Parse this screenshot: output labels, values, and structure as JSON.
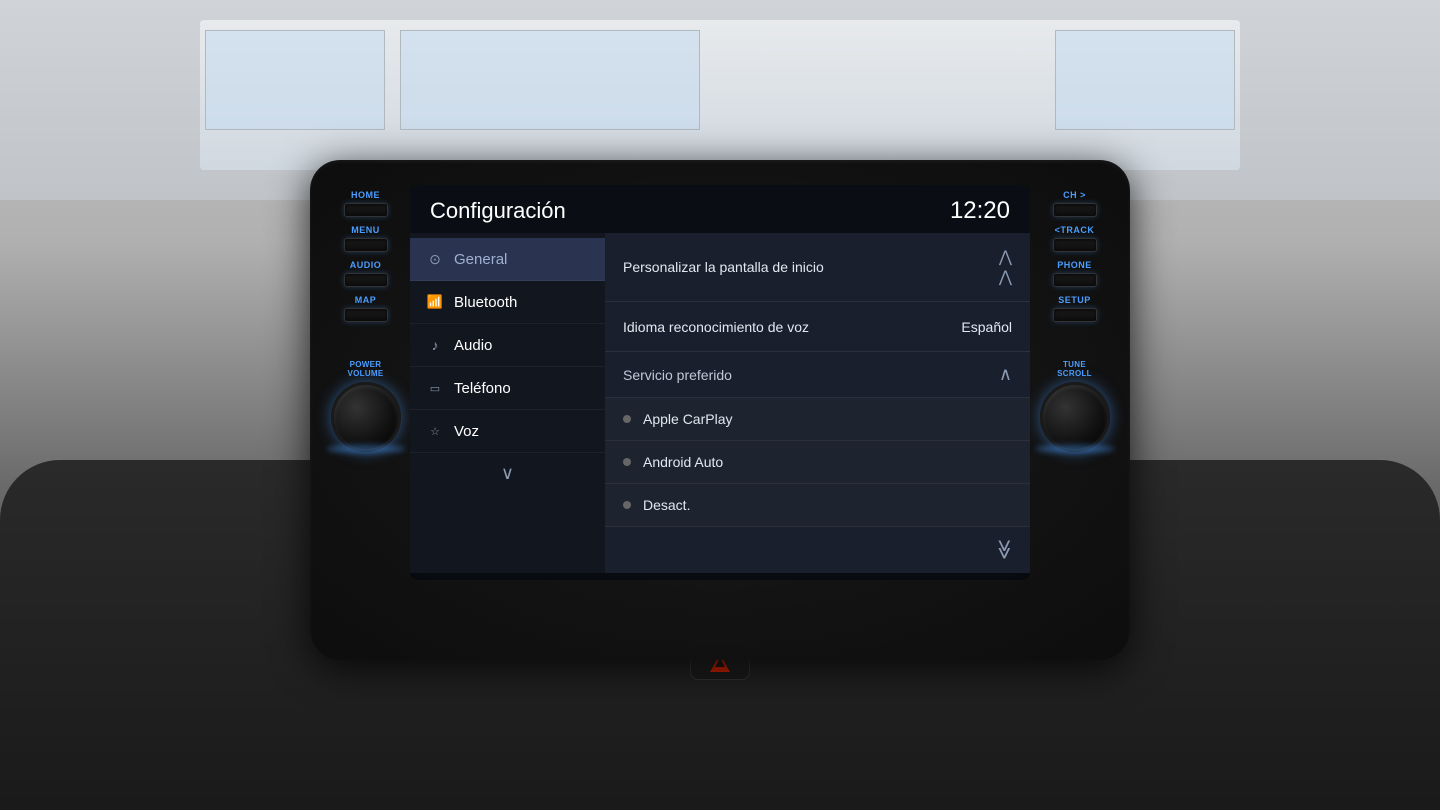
{
  "background": {
    "ceiling_color": "#c8ccd0",
    "dashboard_color": "#1a1a1a"
  },
  "unit": {
    "left_buttons": [
      {
        "label": "HOME",
        "id": "home"
      },
      {
        "label": "MENU",
        "id": "menu"
      },
      {
        "label": "AUDIO",
        "id": "audio"
      },
      {
        "label": "MAP",
        "id": "map"
      }
    ],
    "left_knob_label": "POWER\nVOLUME",
    "right_buttons": [
      {
        "label": "CH >",
        "id": "ch"
      },
      {
        "label": "<TRACK",
        "id": "track"
      },
      {
        "label": "PHONE",
        "id": "phone"
      },
      {
        "label": "SETUP",
        "id": "setup"
      }
    ],
    "right_knob_label": "TUNE\nSCROLL"
  },
  "screen": {
    "title": "Configuración",
    "time": "12:20",
    "menu": {
      "items": [
        {
          "id": "general",
          "icon": "⊙",
          "label": "General",
          "active": true
        },
        {
          "id": "bluetooth",
          "icon": "⦿",
          "label": "Bluetooth",
          "active": false
        },
        {
          "id": "audio",
          "icon": "♪",
          "label": "Audio",
          "active": false
        },
        {
          "id": "telefono",
          "icon": "□",
          "label": "Teléfono",
          "active": false
        },
        {
          "id": "voz",
          "icon": "☆",
          "label": "Voz",
          "active": false
        }
      ],
      "more_label": "∨"
    },
    "content": {
      "rows": [
        {
          "id": "personalizar",
          "text": "Personalizar la pantalla de inicio",
          "value": "",
          "has_double_chevron": true
        },
        {
          "id": "idioma",
          "text": "Idioma reconocimiento de voz",
          "value": "Español",
          "has_double_chevron": false
        }
      ],
      "servicio": {
        "label": "Servicio preferido",
        "expanded": true,
        "options": [
          {
            "id": "carplay",
            "label": "Apple CarPlay",
            "selected": false
          },
          {
            "id": "android",
            "label": "Android Auto",
            "selected": false
          },
          {
            "id": "desact",
            "label": "Desact.",
            "selected": false
          }
        ],
        "scroll_down_icon": "⋙"
      }
    }
  }
}
